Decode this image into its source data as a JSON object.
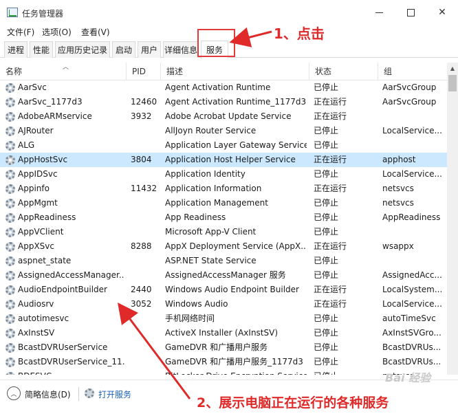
{
  "window": {
    "title": "任务管理器"
  },
  "menu": [
    "文件(F)",
    "选项(O)",
    "查看(V)"
  ],
  "tabs": [
    "进程",
    "性能",
    "应用历史记录",
    "启动",
    "用户",
    "详细信息",
    "服务"
  ],
  "active_tab": "服务",
  "columns": {
    "name": "名称",
    "pid": "PID",
    "desc": "描述",
    "status": "状态",
    "group": "组"
  },
  "services": [
    {
      "name": "AarSvc",
      "pid": "",
      "desc": "Agent Activation Runtime",
      "status": "已停止",
      "group": "AarSvcGroup"
    },
    {
      "name": "AarSvc_1177d3",
      "pid": "12460",
      "desc": "Agent Activation Runtime_1177d3",
      "status": "正在运行",
      "group": "AarSvcGroup"
    },
    {
      "name": "AdobeARMservice",
      "pid": "3932",
      "desc": "Adobe Acrobat Update Service",
      "status": "正在运行",
      "group": ""
    },
    {
      "name": "AJRouter",
      "pid": "",
      "desc": "AllJoyn Router Service",
      "status": "已停止",
      "group": "LocalService..."
    },
    {
      "name": "ALG",
      "pid": "",
      "desc": "Application Layer Gateway Service",
      "status": "已停止",
      "group": ""
    },
    {
      "name": "AppHostSvc",
      "pid": "3804",
      "desc": "Application Host Helper Service",
      "status": "正在运行",
      "group": "apphost",
      "selected": true
    },
    {
      "name": "AppIDSvc",
      "pid": "",
      "desc": "Application Identity",
      "status": "已停止",
      "group": "LocalService..."
    },
    {
      "name": "Appinfo",
      "pid": "11432",
      "desc": "Application Information",
      "status": "正在运行",
      "group": "netsvcs"
    },
    {
      "name": "AppMgmt",
      "pid": "",
      "desc": "Application Management",
      "status": "已停止",
      "group": "netsvcs"
    },
    {
      "name": "AppReadiness",
      "pid": "",
      "desc": "App Readiness",
      "status": "已停止",
      "group": "AppReadiness"
    },
    {
      "name": "AppVClient",
      "pid": "",
      "desc": "Microsoft App-V Client",
      "status": "已停止",
      "group": ""
    },
    {
      "name": "AppXSvc",
      "pid": "8288",
      "desc": "AppX Deployment Service (AppX...",
      "status": "正在运行",
      "group": "wsappx"
    },
    {
      "name": "aspnet_state",
      "pid": "",
      "desc": "ASP.NET State Service",
      "status": "已停止",
      "group": ""
    },
    {
      "name": "AssignedAccessManager...",
      "pid": "",
      "desc": "AssignedAccessManager 服务",
      "status": "已停止",
      "group": "AssignedAcc..."
    },
    {
      "name": "AudioEndpointBuilder",
      "pid": "2440",
      "desc": "Windows Audio Endpoint Builder",
      "status": "正在运行",
      "group": "LocalSystem..."
    },
    {
      "name": "Audiosrv",
      "pid": "3052",
      "desc": "Windows Audio",
      "status": "正在运行",
      "group": "LocalService..."
    },
    {
      "name": "autotimesvc",
      "pid": "",
      "desc": "手机网络时间",
      "status": "已停止",
      "group": "autoTimeSvc"
    },
    {
      "name": "AxInstSV",
      "pid": "",
      "desc": "ActiveX Installer (AxInstSV)",
      "status": "已停止",
      "group": "AxInstSVGro..."
    },
    {
      "name": "BcastDVRUserService",
      "pid": "",
      "desc": "GameDVR 和广播用户服务",
      "status": "已停止",
      "group": "BcastDVRUs..."
    },
    {
      "name": "BcastDVRUserService_11...",
      "pid": "",
      "desc": "GameDVR 和广播用户服务_1177d3",
      "status": "已停止",
      "group": "BcastDVRUs..."
    },
    {
      "name": "BDESVC",
      "pid": "",
      "desc": "BitLocker Drive Encryption Service",
      "status": "已停止",
      "group": "netsvcs"
    }
  ],
  "statusbar": {
    "fewer_details": "简略信息(D)",
    "open_services": "打开服务"
  },
  "annotations": {
    "step1": "1、点击",
    "step2": "2、展示电脑正在运行的各种服务"
  },
  "watermark": "Bai 经验",
  "colors": {
    "selected_row": "#cce8ff",
    "annotation_red": "#e02a2a",
    "link_blue": "#1a5fb4"
  },
  "icons": {
    "service": "gear-icon",
    "app": "task-manager-icon"
  }
}
